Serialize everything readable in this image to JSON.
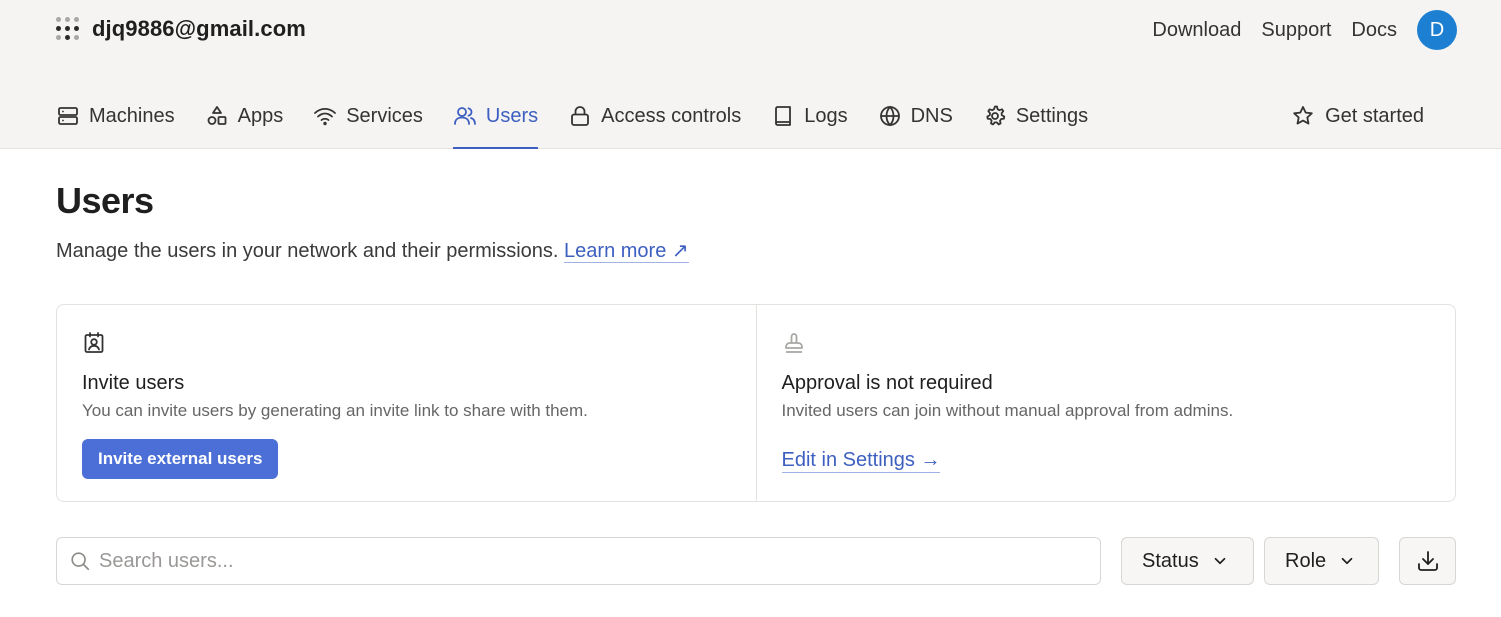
{
  "header": {
    "account_email": "djq9886@gmail.com",
    "links": [
      "Download",
      "Support",
      "Docs"
    ],
    "avatar_initial": "D"
  },
  "nav": {
    "items": [
      {
        "label": "Machines",
        "icon": "server-icon"
      },
      {
        "label": "Apps",
        "icon": "apps-icon"
      },
      {
        "label": "Services",
        "icon": "wifi-icon"
      },
      {
        "label": "Users",
        "icon": "users-icon",
        "active": true
      },
      {
        "label": "Access controls",
        "icon": "lock-icon"
      },
      {
        "label": "Logs",
        "icon": "book-icon"
      },
      {
        "label": "DNS",
        "icon": "globe-icon"
      },
      {
        "label": "Settings",
        "icon": "gear-icon"
      }
    ],
    "get_started": "Get started"
  },
  "page": {
    "title": "Users",
    "description": "Manage the users in your network and their permissions.",
    "learn_more": "Learn more ↗"
  },
  "cards": {
    "invite": {
      "title": "Invite users",
      "text": "You can invite users by generating an invite link to share with them.",
      "button": "Invite external users"
    },
    "approval": {
      "title": "Approval is not required",
      "text": "Invited users can join without manual approval from admins.",
      "link": "Edit in Settings →"
    }
  },
  "toolbar": {
    "search_placeholder": "Search users...",
    "status_filter": "Status",
    "role_filter": "Role"
  },
  "colors": {
    "accent": "#3d5fc0",
    "primary_button": "#4b6fd6",
    "avatar": "#1d7fd1",
    "header_bg": "#f5f4f2"
  }
}
